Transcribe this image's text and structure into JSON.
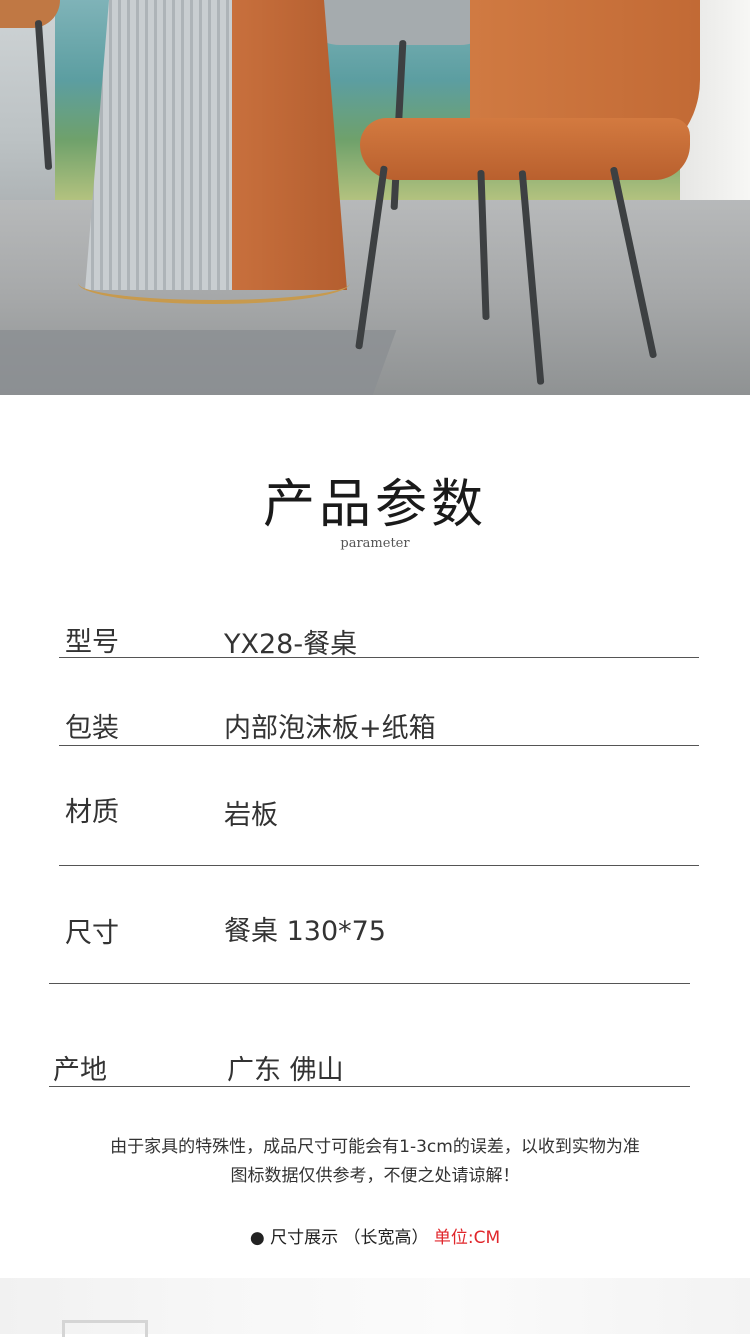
{
  "section": {
    "title": "产品参数",
    "subtitle": "parameter"
  },
  "params": [
    {
      "label": "型号",
      "value": "YX28-餐桌"
    },
    {
      "label": "包装",
      "value": "内部泡沫板+纸箱"
    },
    {
      "label": "材质",
      "value": "岩板"
    },
    {
      "label": "尺寸",
      "value": "餐桌 130*75"
    },
    {
      "label": "产地",
      "value": "广东 佛山"
    }
  ],
  "note": {
    "line1": "由于家具的特殊性，成品尺寸可能会有1-3cm的误差，以收到实物为准",
    "line2": "图标数据仅供参考，不便之处请谅解！"
  },
  "size_display": {
    "bullet": "●",
    "label": "尺寸展示 （长宽高）",
    "unit": "单位:CM"
  },
  "colors": {
    "unit_red": "#e0262b",
    "chair_orange": "#c8703d"
  }
}
